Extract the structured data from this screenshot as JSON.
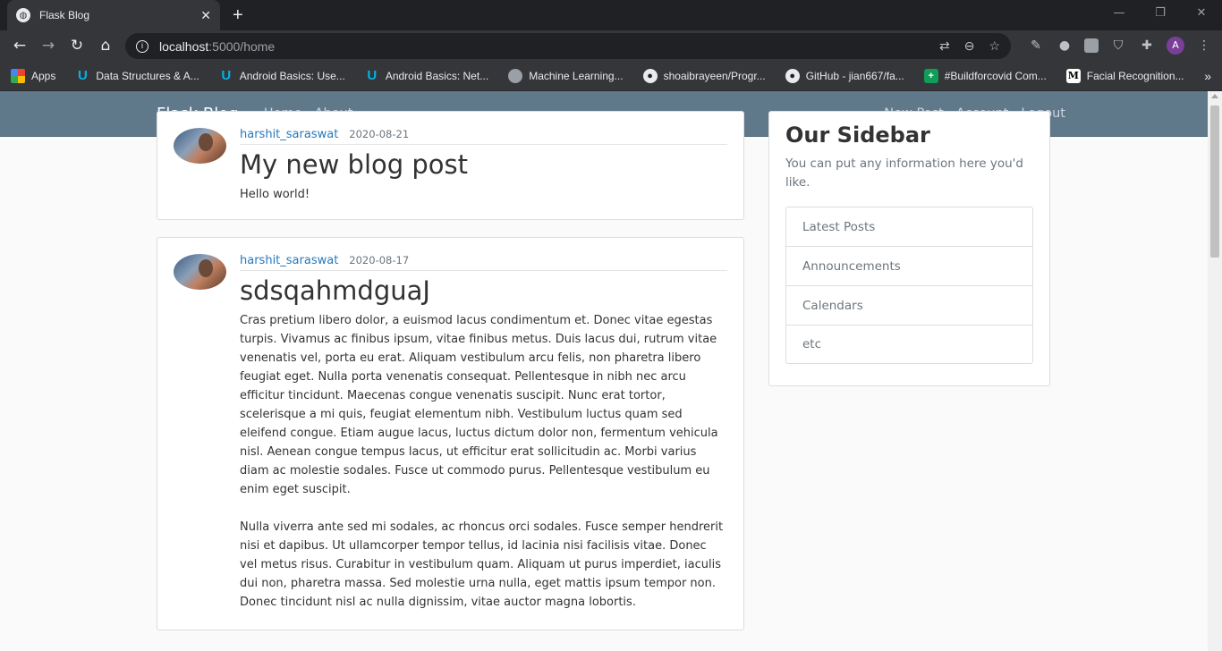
{
  "browser": {
    "tab_title": "Flask Blog",
    "tab_close": "✕",
    "new_tab": "+",
    "url_host": "localhost",
    "url_path": ":5000/home",
    "bookmarks": [
      {
        "icon": "apps-icon",
        "label": "Apps"
      },
      {
        "icon": "udacity-icon",
        "label": "Data Structures & A..."
      },
      {
        "icon": "udacity-icon",
        "label": "Android Basics: Use..."
      },
      {
        "icon": "udacity-icon",
        "label": "Android Basics: Net..."
      },
      {
        "icon": "brain-icon",
        "label": "Machine Learning..."
      },
      {
        "icon": "github-icon",
        "label": "shoaibrayeen/Progr..."
      },
      {
        "icon": "github-icon",
        "label": "GitHub - jian667/fa..."
      },
      {
        "icon": "plus-square-icon",
        "label": "#Buildforcovid Com..."
      },
      {
        "icon": "medium-icon",
        "label": "Facial Recognition..."
      }
    ],
    "more_bookmarks": "»"
  },
  "site_nav": {
    "brand": "Flask Blog",
    "links_left": [
      "Home",
      "About"
    ],
    "links_right": [
      "New Post",
      "Account",
      "Logout"
    ]
  },
  "posts": [
    {
      "author": "harshit_saraswat",
      "date": "2020-08-21",
      "title": "My new blog post",
      "content": "Hello world!"
    },
    {
      "author": "harshit_saraswat",
      "date": "2020-08-17",
      "title": "sdsqahmdguaJ",
      "content": "Cras pretium libero dolor, a euismod lacus condimentum et. Donec vitae egestas turpis. Vivamus ac finibus ipsum, vitae finibus metus. Duis lacus dui, rutrum vitae venenatis vel, porta eu erat. Aliquam vestibulum arcu felis, non pharetra libero feugiat eget. Nulla porta venenatis consequat. Pellentesque in nibh nec arcu efficitur tincidunt. Maecenas congue venenatis suscipit. Nunc erat tortor, scelerisque a mi quis, feugiat elementum nibh. Vestibulum luctus quam sed eleifend congue. Etiam augue lacus, luctus dictum dolor non, fermentum vehicula nisl. Aenean congue tempus lacus, ut efficitur erat sollicitudin ac. Morbi varius diam ac molestie sodales. Fusce ut commodo purus. Pellentesque vestibulum eu enim eget suscipit.\n\nNulla viverra ante sed mi sodales, ac rhoncus orci sodales. Fusce semper hendrerit nisi et dapibus. Ut ullamcorper tempor tellus, id lacinia nisi facilisis vitae. Donec vel metus risus. Curabitur in vestibulum quam. Aliquam ut purus imperdiet, iaculis dui non, pharetra massa. Sed molestie urna nulla, eget mattis ipsum tempor non. Donec tincidunt nisl ac nulla dignissim, vitae auctor magna lobortis."
    }
  ],
  "sidebar": {
    "title": "Our Sidebar",
    "text": "You can put any information here you'd like.",
    "items": [
      "Latest Posts",
      "Announcements",
      "Calendars",
      "etc"
    ]
  }
}
